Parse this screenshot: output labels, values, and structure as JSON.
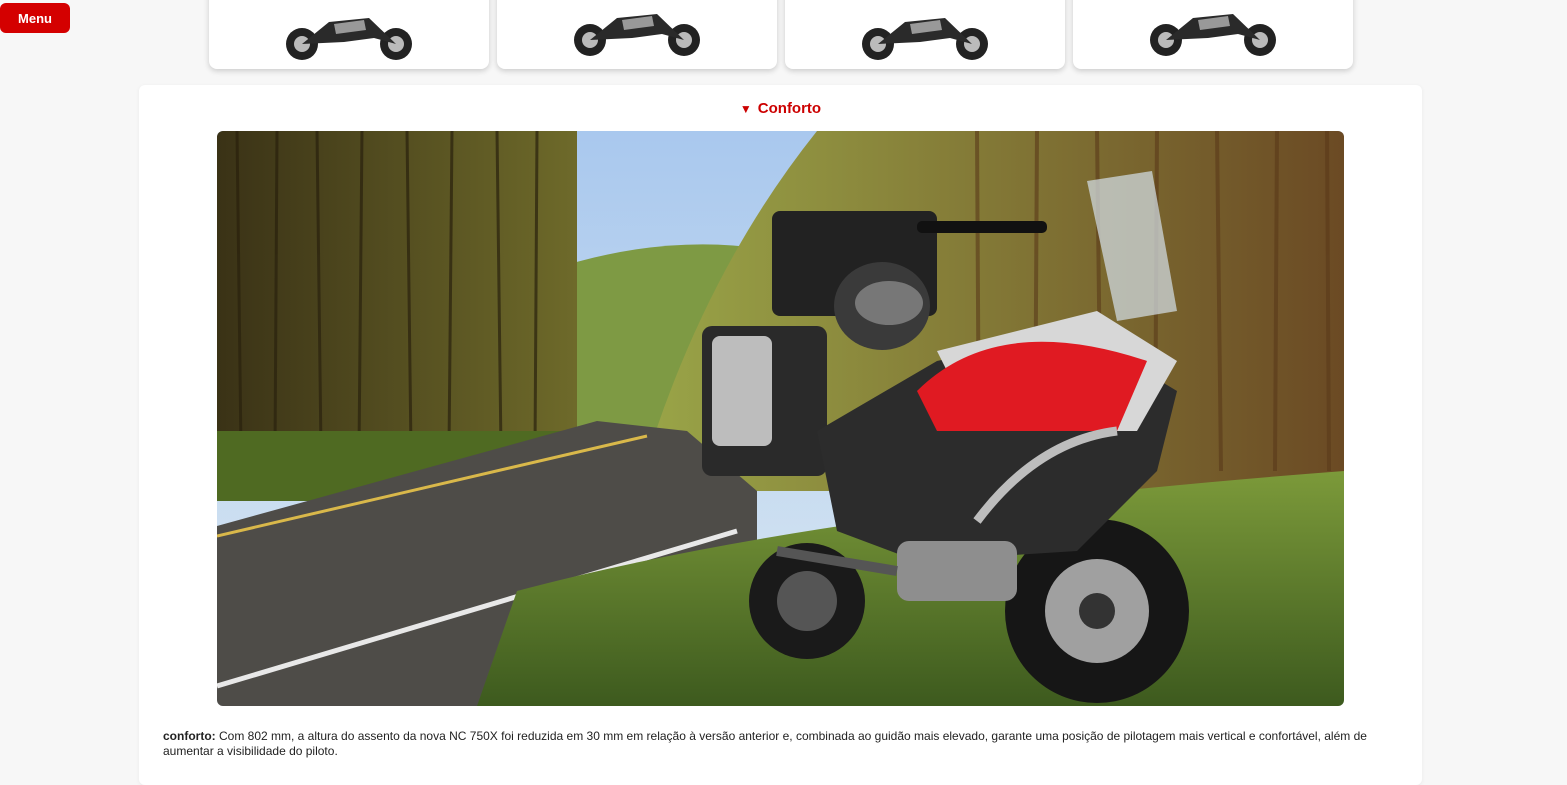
{
  "menu": {
    "label": "Menu"
  },
  "thumbnails": [
    {
      "name": "moto-thumb-1"
    },
    {
      "name": "moto-thumb-2"
    },
    {
      "name": "moto-thumb-3"
    },
    {
      "name": "moto-thumb-4"
    }
  ],
  "section": {
    "arrow": "▼",
    "title": "Conforto",
    "image_alt": "hero-photo-icon",
    "desc_label": "conforto:",
    "desc_text": " Com 802 mm, a altura do assento da nova NC 750X foi reduzida em 30 mm em relação à versão anterior e, combinada ao guidão mais elevado, garante uma posição de pilotagem mais vertical e confortável, além de aumentar a visibilidade do piloto."
  },
  "colors": {
    "accent": "#d40000",
    "title": "#cc0000"
  }
}
